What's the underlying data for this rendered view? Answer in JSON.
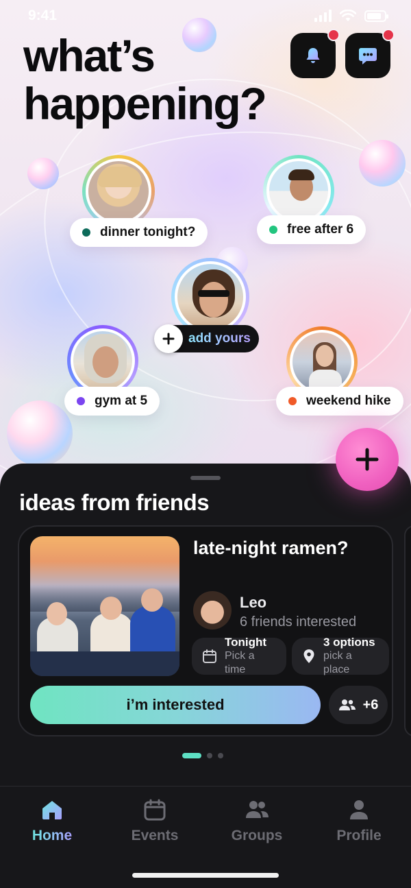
{
  "status_bar": {
    "time": "9:41"
  },
  "header": {
    "title_line1": "what’s",
    "title_line2": "happening?"
  },
  "top_buttons": {
    "notifications_icon": "bell-icon",
    "messages_icon": "chat-bubble-icon",
    "badge_color": "#e5344a"
  },
  "statuses": [
    {
      "text": "dinner tonight?",
      "dot_color": "#0d6b5a"
    },
    {
      "text": "free after 6",
      "dot_color": "#22c57f"
    },
    {
      "text": "gym at 5",
      "dot_color": "#7b45f0"
    },
    {
      "text": "weekend hike",
      "dot_color": "#f05a28"
    }
  ],
  "add_yours": {
    "label": "add yours"
  },
  "ideas": {
    "section_title": "ideas from friends",
    "card": {
      "title": "late-night ramen?",
      "author": "Leo",
      "interest": "6 friends interested",
      "time_label": "Tonight",
      "time_hint": "Pick a time",
      "place_label": "3 options",
      "place_hint": "pick a place",
      "cta": "i’m interested",
      "others_count": "+6"
    },
    "pager": {
      "count": 3,
      "active": 1
    }
  },
  "tabbar": {
    "items": [
      {
        "label": "Home",
        "icon": "home-icon",
        "active": true
      },
      {
        "label": "Events",
        "icon": "calendar-icon",
        "active": false
      },
      {
        "label": "Groups",
        "icon": "people-icon",
        "active": false
      },
      {
        "label": "Profile",
        "icon": "person-icon",
        "active": false
      }
    ]
  },
  "colors": {
    "accent_teal": "#5ee0c4",
    "accent_pink": "#f061c0",
    "sheet_bg": "#17171a"
  }
}
